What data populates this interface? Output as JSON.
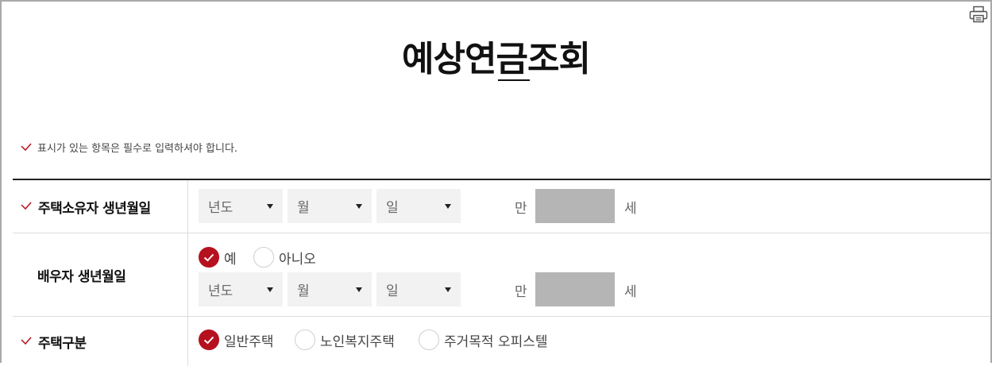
{
  "header": {
    "title": "예상연금조회",
    "print_icon": "printer-icon"
  },
  "notice": {
    "icon": "check-icon",
    "text": "표시가 있는 항목은 필수로 입력하셔야 합니다."
  },
  "colors": {
    "accent": "#b5111f",
    "select_bg": "#f2f2f2",
    "age_box_bg": "#b5b5b5",
    "border": "#dcdcdc"
  },
  "form": {
    "owner_birth": {
      "label": "주택소유자 생년월일",
      "required": true,
      "year_placeholder": "년도",
      "month_placeholder": "월",
      "day_placeholder": "일",
      "age_prefix": "만",
      "age_value": "",
      "age_suffix": "세"
    },
    "spouse_birth": {
      "label": "배우자 생년월일",
      "required": false,
      "options": [
        {
          "label": "예",
          "checked": true
        },
        {
          "label": "아니오",
          "checked": false
        }
      ],
      "year_placeholder": "년도",
      "month_placeholder": "월",
      "day_placeholder": "일",
      "age_prefix": "만",
      "age_value": "",
      "age_suffix": "세"
    },
    "house_type": {
      "label": "주택구분",
      "required": true,
      "options": [
        {
          "label": "일반주택",
          "checked": true
        },
        {
          "label": "노인복지주택",
          "checked": false
        },
        {
          "label": "주거목적 오피스텔",
          "checked": false
        }
      ]
    }
  }
}
